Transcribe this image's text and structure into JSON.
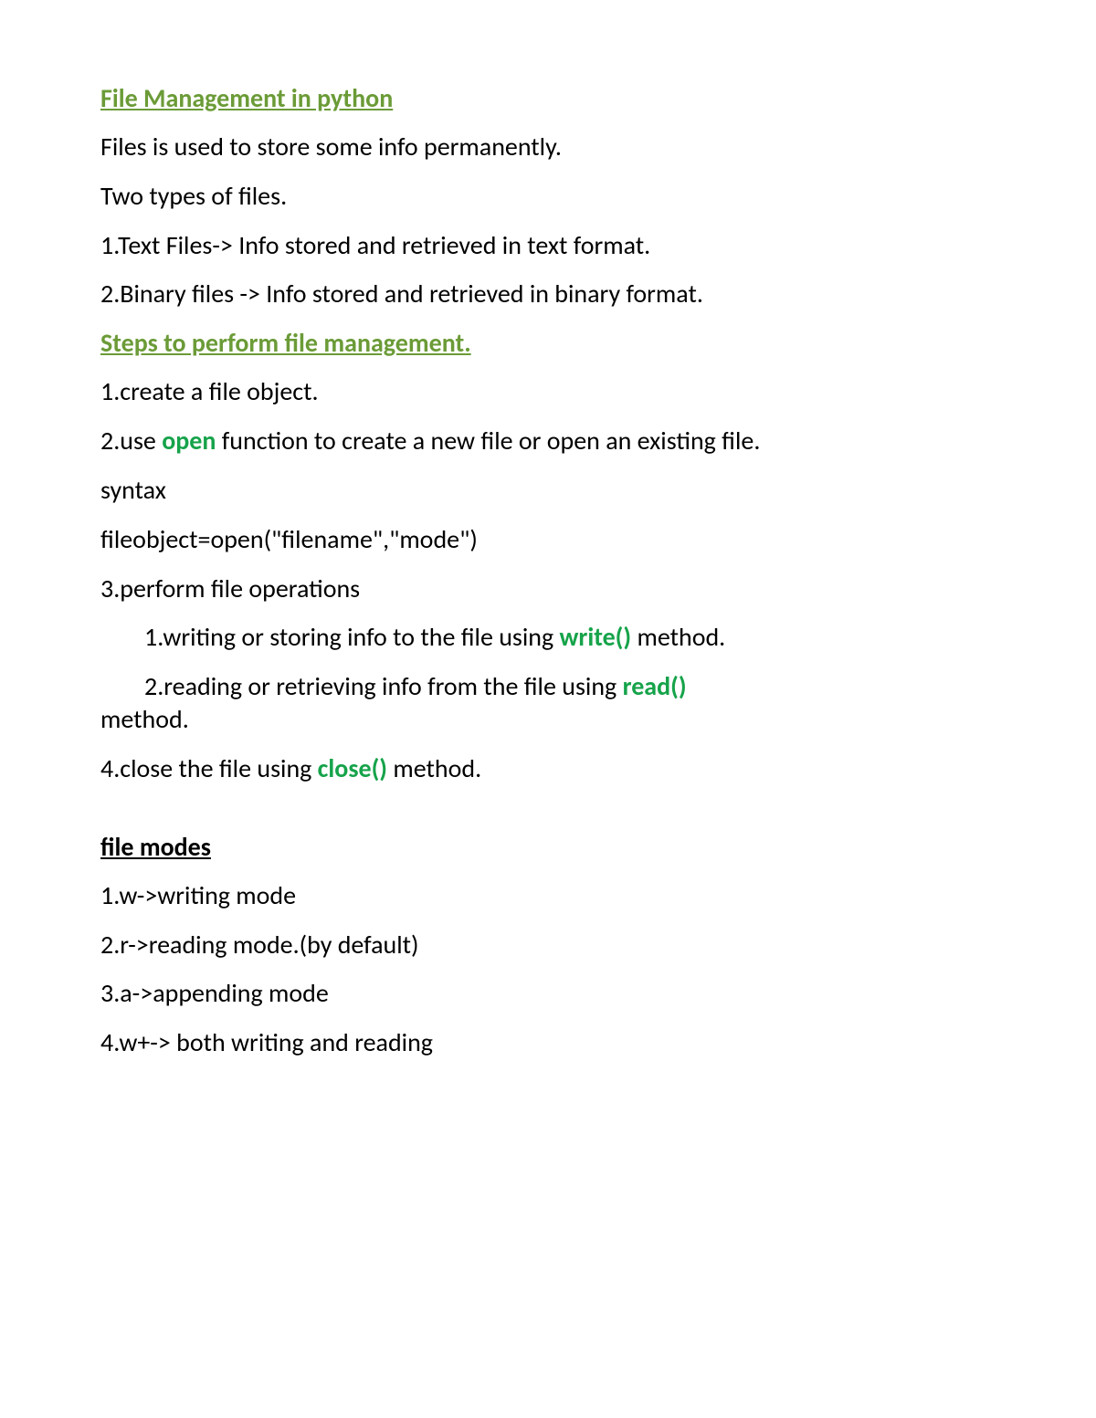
{
  "title1": "File Management in python",
  "p1": "Files is used to store some info permanently.",
  "p2": "Two types of files.",
  "p3": "1.Text Files-> Info stored and retrieved in text format.",
  "p4": "2.Binary files -> Info stored and retrieved in binary format.",
  "title2": "Steps to perform file management.",
  "s1": "1.create a file object.",
  "s2a": "2.use ",
  "s2kw": "open",
  "s2b": " function to create a new file or open an existing file.",
  "s3": "syntax",
  "s4": "fileobject=open(\"filename\",\"mode\")",
  "s5": "3.perform file operations",
  "s6a": "1.writing or storing info to the file using ",
  "s6kw": "write()",
  "s6b": " method.",
  "s7a": "2.reading or retrieving info from the file using ",
  "s7kw": "read()",
  "s7b": "method.",
  "s8a": "4.close the file using ",
  "s8kw": "close()",
  "s8b": " method.",
  "title3": "file modes",
  "m1": "1.w->writing mode",
  "m2": "2.r->reading mode.(by default)",
  "m3": "3.a->appending mode",
  "m4": "4.w+-> both writing and reading"
}
